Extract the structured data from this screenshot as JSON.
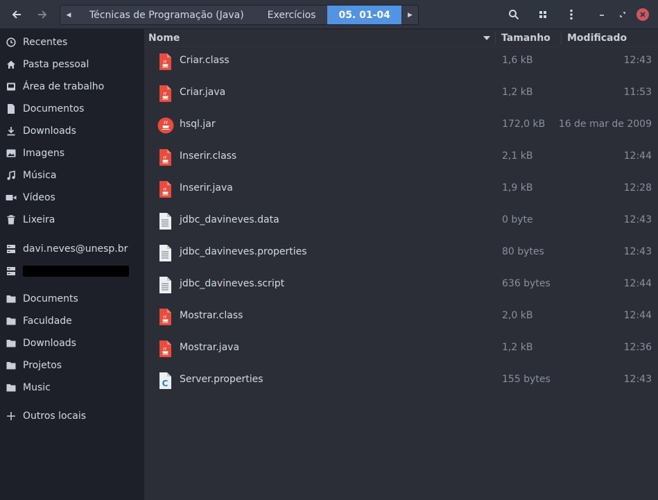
{
  "header": {
    "back_icon": "arrow-left-icon",
    "forward_icon": "arrow-right-icon",
    "breadcrumbs": [
      "Técnicas de Programação (Java)",
      "Exercícios",
      "05. 01-04"
    ],
    "search_icon": "search-icon",
    "view_icon": "grid-view-icon",
    "menu_icon": "kebab-menu-icon"
  },
  "sidebar": {
    "items": [
      {
        "label": "Recentes",
        "icon": "clock-icon"
      },
      {
        "label": "Pasta pessoal",
        "icon": "home-icon"
      },
      {
        "label": "Área de trabalho",
        "icon": "desktop-icon"
      },
      {
        "label": "Documentos",
        "icon": "document-icon"
      },
      {
        "label": "Downloads",
        "icon": "download-icon"
      },
      {
        "label": "Imagens",
        "icon": "image-icon"
      },
      {
        "label": "Música",
        "icon": "music-icon"
      },
      {
        "label": "Vídeos",
        "icon": "video-icon"
      },
      {
        "label": "Lixeira",
        "icon": "trash-icon"
      },
      {
        "label": "davi.neves@unesp.br",
        "icon": "network-drive-icon"
      },
      {
        "label": "",
        "icon": "network-drive-icon"
      },
      {
        "label": "Documents",
        "icon": "folder-icon"
      },
      {
        "label": "Faculdade",
        "icon": "folder-icon"
      },
      {
        "label": "Downloads",
        "icon": "folder-icon"
      },
      {
        "label": "Projetos",
        "icon": "folder-icon"
      },
      {
        "label": "Music",
        "icon": "folder-icon"
      },
      {
        "label": "Outros locais",
        "icon": "plus-icon"
      }
    ]
  },
  "columns": {
    "name": "Nome",
    "size": "Tamanho",
    "modified": "Modificado"
  },
  "files": [
    {
      "name": "Criar.class",
      "size": "1,6 kB",
      "modified": "12:43",
      "type": "java"
    },
    {
      "name": "Criar.java",
      "size": "1,2 kB",
      "modified": "11:53",
      "type": "java"
    },
    {
      "name": "hsql.jar",
      "size": "172,0 kB",
      "modified": "16 de mar de 2009",
      "type": "jar"
    },
    {
      "name": "Inserir.class",
      "size": "2,1 kB",
      "modified": "12:44",
      "type": "java"
    },
    {
      "name": "Inserir.java",
      "size": "1,9 kB",
      "modified": "12:28",
      "type": "java"
    },
    {
      "name": "jdbc_davineves.data",
      "size": "0 byte",
      "modified": "12:43",
      "type": "text"
    },
    {
      "name": "jdbc_davineves.properties",
      "size": "80 bytes",
      "modified": "12:43",
      "type": "text"
    },
    {
      "name": "jdbc_davineves.script",
      "size": "636 bytes",
      "modified": "12:44",
      "type": "text"
    },
    {
      "name": "Mostrar.class",
      "size": "2,0 kB",
      "modified": "12:44",
      "type": "java"
    },
    {
      "name": "Mostrar.java",
      "size": "1,2 kB",
      "modified": "12:36",
      "type": "java"
    },
    {
      "name": "Server.properties",
      "size": "155 bytes",
      "modified": "12:43",
      "type": "source"
    }
  ],
  "colors": {
    "accent": "#5294e2",
    "java_red": "#e74c3c",
    "close_red": "#cc575d"
  }
}
